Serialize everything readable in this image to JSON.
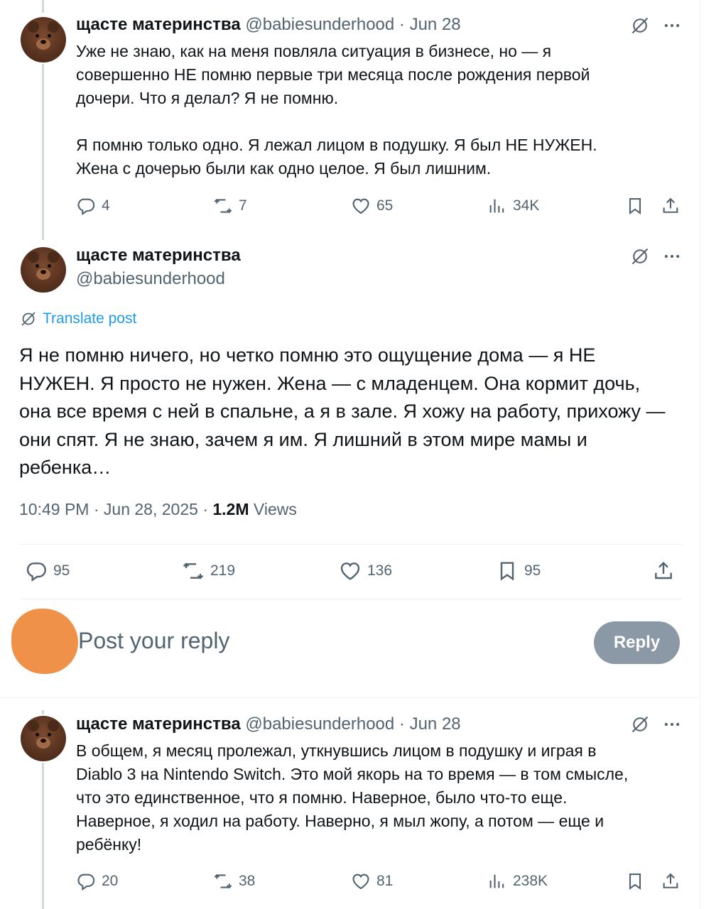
{
  "author": {
    "name": "щасте материнства",
    "handle": "@babiesunderhood"
  },
  "tweet1": {
    "date": "Jun 28",
    "lines": [
      "Уже не знаю, как на меня повляла ситуация в бизнесе, но — я",
      "совершенно НЕ помню первые три месяца после рождения первой",
      "дочери. Что я делал? Я не помню.",
      "",
      "Я помню только одно. Я лежал лицом в подушку. Я был НЕ НУЖЕН.",
      "Жена с дочерью были как одно целое. Я был лишним."
    ],
    "replies": "4",
    "reposts": "7",
    "likes": "65",
    "views": "34K"
  },
  "main": {
    "translate_label": "Translate post",
    "lines": [
      "Я не помню ничего, но четко помню это ощущение дома — я НЕ",
      "НУЖЕН. Я просто не нужен. Жена — с младенцем. Она кормит дочь,",
      "она все время с ней в спальне, а я в зале. Я хожу на работу, прихожу —",
      "они спят. Я не знаю, зачем я им. Я лишний в этом мире мамы и",
      "ребенка…"
    ],
    "time": "10:49 PM",
    "date": "Jun 28, 2025",
    "views_count": "1.2M",
    "views_label": "Views",
    "replies": "95",
    "reposts": "219",
    "likes": "136",
    "bookmarks": "95"
  },
  "composer": {
    "placeholder": "Post your reply",
    "button_label": "Reply"
  },
  "tweet3": {
    "date": "Jun 28",
    "lines": [
      "В общем, я месяц пролежал, уткнувшись лицом в подушку и играя в",
      "Diablo 3 на Nintendo Switch. Это мой якорь на то время — в том смысле,",
      "что это единственное, что я помню. Наверное, было что-то еще.",
      "Наверное, я ходил на работу. Наверно, я мыл жопу, а потом — еще и",
      "ребёнку!"
    ],
    "replies": "20",
    "reposts": "38",
    "likes": "81",
    "views": "238K"
  },
  "separator": "·",
  "icons": {
    "reply": "reply-icon",
    "repost": "repost-icon",
    "like": "heart-icon",
    "views": "views-chart-icon",
    "bookmark": "bookmark-icon",
    "share": "share-icon",
    "grok": "grok-icon",
    "more": "more-icon",
    "translate": "translate-icon"
  },
  "colors": {
    "text": "#0f1419",
    "muted": "#536471",
    "link": "#1d9bf0",
    "reply_button": "#8b98a5",
    "reply_avatar": "#f0914a",
    "thread_line": "#cfd9de"
  }
}
